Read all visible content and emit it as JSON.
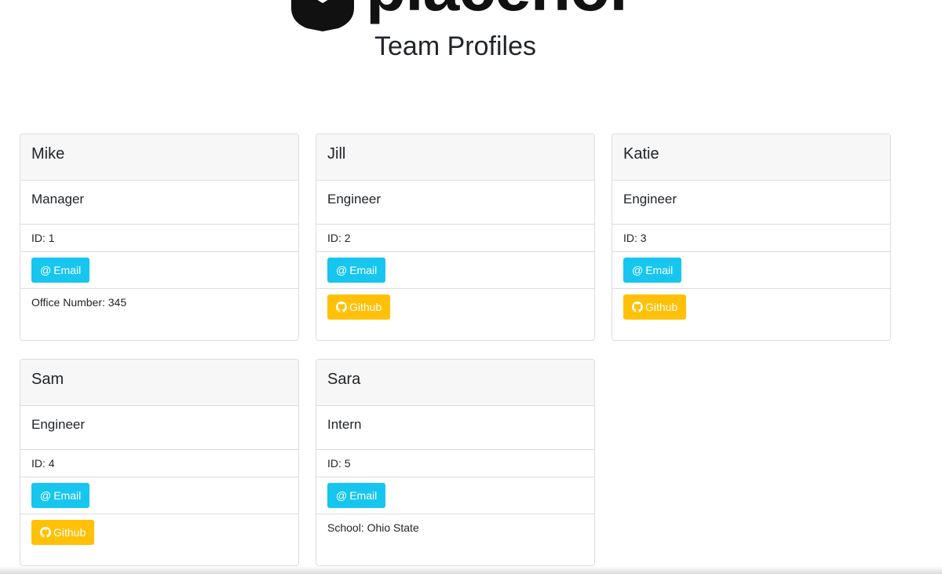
{
  "header": {
    "logo_text": "placeholder",
    "title": "Team Profiles"
  },
  "colors": {
    "email_button": "#17c6ef",
    "github_button": "#ffc107",
    "card_header_bg": "#f7f7f7"
  },
  "cards": [
    {
      "name": "Mike",
      "role": "Manager",
      "id_text": "ID: 1",
      "email_label": "Email",
      "extra_type": "office",
      "extra_text": "Office Number: 345"
    },
    {
      "name": "Jill",
      "role": "Engineer",
      "id_text": "ID: 2",
      "email_label": "Email",
      "extra_type": "github",
      "github_label": "Github"
    },
    {
      "name": "Katie",
      "role": "Engineer",
      "id_text": "ID: 3",
      "email_label": "Email",
      "extra_type": "github",
      "github_label": "Github"
    },
    {
      "name": "Sam",
      "role": "Engineer",
      "id_text": "ID: 4",
      "email_label": "Email",
      "extra_type": "github",
      "github_label": "Github"
    },
    {
      "name": "Sara",
      "role": "Intern",
      "id_text": "ID: 5",
      "email_label": "Email",
      "extra_type": "school",
      "extra_text": "School: Ohio State"
    }
  ],
  "icons": {
    "email": "at-sign-icon",
    "github": "github-icon",
    "logo": "placeholder-logo-icon"
  }
}
